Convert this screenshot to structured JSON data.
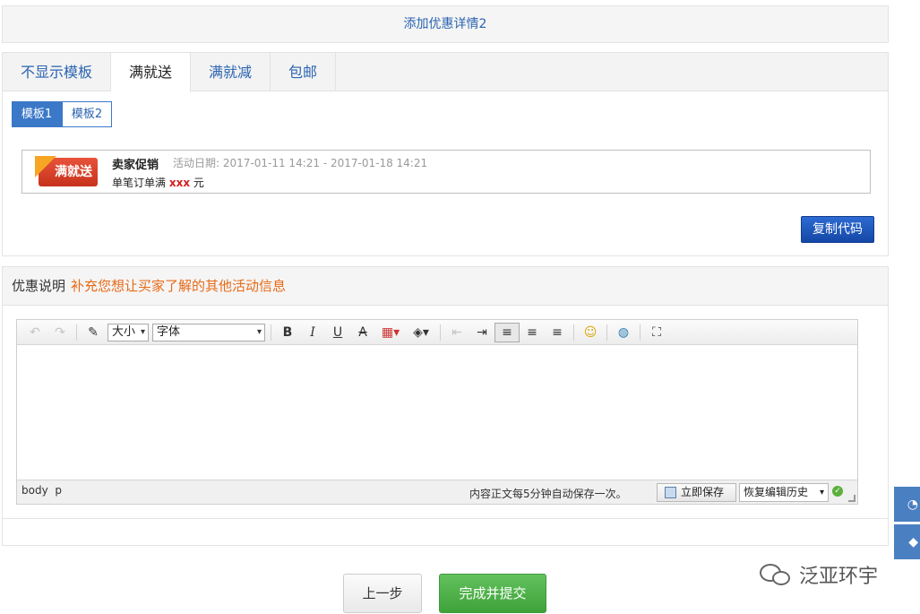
{
  "header": {
    "title": "添加优惠详情2"
  },
  "tabs": [
    {
      "label": "不显示模板"
    },
    {
      "label": "满就送"
    },
    {
      "label": "满就减"
    },
    {
      "label": "包邮"
    }
  ],
  "active_tab": 1,
  "templates": [
    {
      "label": "模板1"
    },
    {
      "label": "模板2"
    }
  ],
  "promo": {
    "logo_text": "满就送",
    "title": "卖家促销",
    "date_label": "活动日期:",
    "date_range": "2017-01-11 14:21 - 2017-01-18 14:21",
    "line_prefix": "单笔订单满",
    "line_value": "xxx",
    "line_suffix": "元"
  },
  "copy_button": "复制代码",
  "description": {
    "title": "优惠说明",
    "hint": "补充您想让买家了解的其他活动信息"
  },
  "editor": {
    "size_select": "大小",
    "font_select": "字体",
    "toolbar_icons": [
      "undo-icon",
      "redo-icon",
      "format-painter-icon",
      "bold-icon",
      "italic-icon",
      "underline-icon",
      "strikethrough-icon",
      "font-color-icon",
      "background-color-icon",
      "outdent-icon",
      "indent-icon",
      "align-left-icon",
      "align-center-icon",
      "align-right-icon",
      "emoticon-icon",
      "link-icon",
      "fullscreen-icon"
    ],
    "path_body": "body",
    "path_p": "p",
    "autosave_text": "内容正文每5分钟自动保存一次。",
    "save_now": "立即保存",
    "restore_history": "恢复编辑历史"
  },
  "buttons": {
    "prev": "上一步",
    "submit": "完成并提交"
  },
  "watermark": "泛亚环宇"
}
